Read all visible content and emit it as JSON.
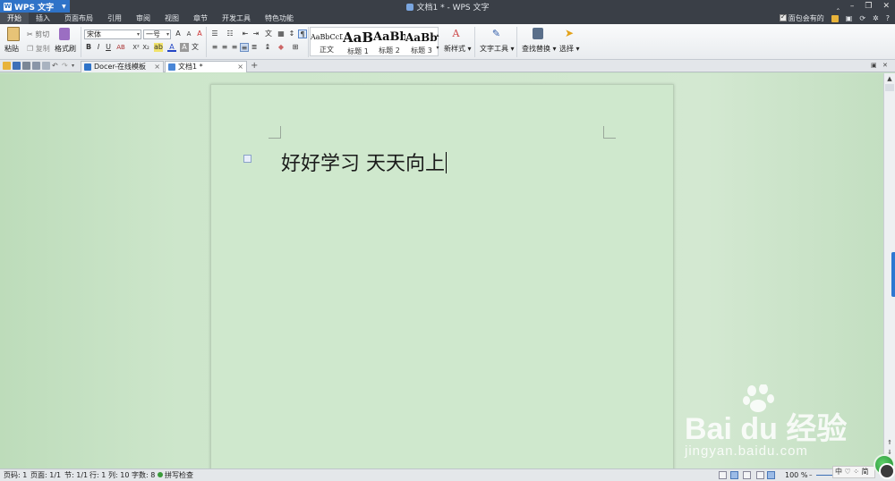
{
  "app": {
    "name": "WPS 文字",
    "window_title": "文档1 * - WPS 文字"
  },
  "menu": {
    "tabs": [
      "开始",
      "插入",
      "页面布局",
      "引用",
      "审阅",
      "视图",
      "章节",
      "开发工具",
      "特色功能"
    ],
    "active_tab": "开始",
    "member_label": "面包会有的"
  },
  "ribbon": {
    "paste": "粘贴",
    "cut": "剪切",
    "copy": "复制",
    "format_painter": "格式刷",
    "font_name": "宋体",
    "font_size": "一号",
    "styles": [
      {
        "preview": "AaBbCcDd",
        "label": "正文"
      },
      {
        "preview": "AaB",
        "label": "标题 1"
      },
      {
        "preview": "AaBb",
        "label": "标题 2"
      },
      {
        "preview": "AaBb(",
        "label": "标题 3"
      }
    ],
    "new_style": "新样式",
    "text_tools": "文字工具",
    "find_replace": "查找替换",
    "select": "选择"
  },
  "tabs": [
    {
      "label": "Docer-在线模板",
      "active": false
    },
    {
      "label": "文档1 *",
      "active": true
    }
  ],
  "document": {
    "text": "好好学习  天天向上"
  },
  "watermark": {
    "main": "Bai du 经验",
    "sub": "jingyan.baidu.com"
  },
  "status": {
    "page_num": "页码: 1",
    "pages": "页面: 1/1",
    "section": "节: 1/1",
    "line": "行: 1",
    "col": "列: 10",
    "word_count": "字数: 8",
    "spell_check": "拼写检查",
    "zoom": "100 %",
    "ime": "中 ♡ ⁘ 简"
  },
  "colors": {
    "titlebar": "#3a3f47",
    "accent": "#2f73c8",
    "page_bg": "#cfe8cd"
  }
}
